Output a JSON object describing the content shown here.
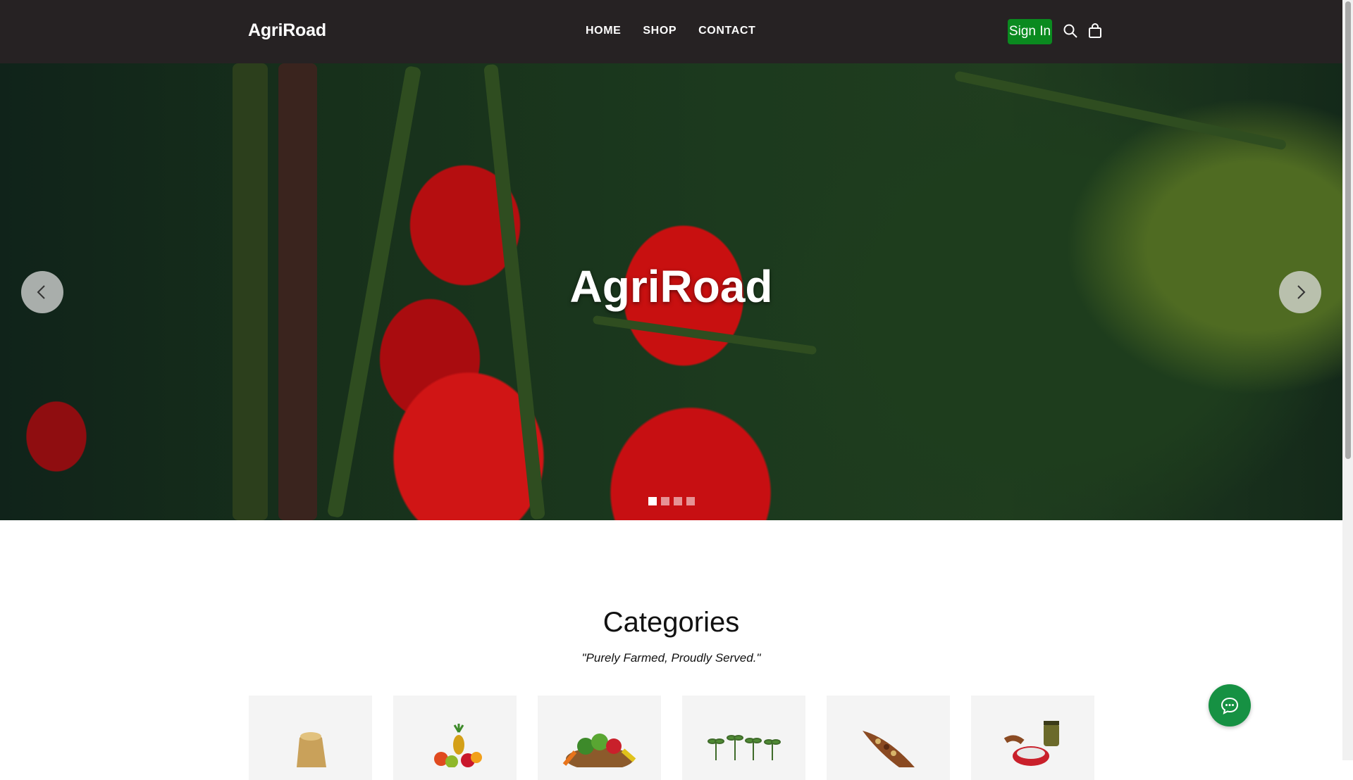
{
  "header": {
    "logo": "AgriRoad",
    "nav": [
      "HOME",
      "SHOP",
      "CONTACT"
    ],
    "sign_in": "Sign In",
    "icons": [
      "search-icon",
      "shopping-bag-icon"
    ]
  },
  "hero": {
    "title": "AgriRoad",
    "slide_count": 4,
    "active_slide": 1,
    "controls": [
      "chevron-left-icon",
      "chevron-right-icon"
    ]
  },
  "categories": {
    "title": "Categories",
    "tagline": "\"Purely Farmed, Proudly Served.\"",
    "items": [
      "grain-sack",
      "fruit-basket",
      "vegetable-basket",
      "seedlings",
      "dry-fruits",
      "pickles"
    ]
  },
  "chat": {
    "icon": "chat-icon"
  },
  "colors": {
    "header_bg": "#262223",
    "accent_green": "#0a8a1f",
    "chat_green": "#169143"
  }
}
